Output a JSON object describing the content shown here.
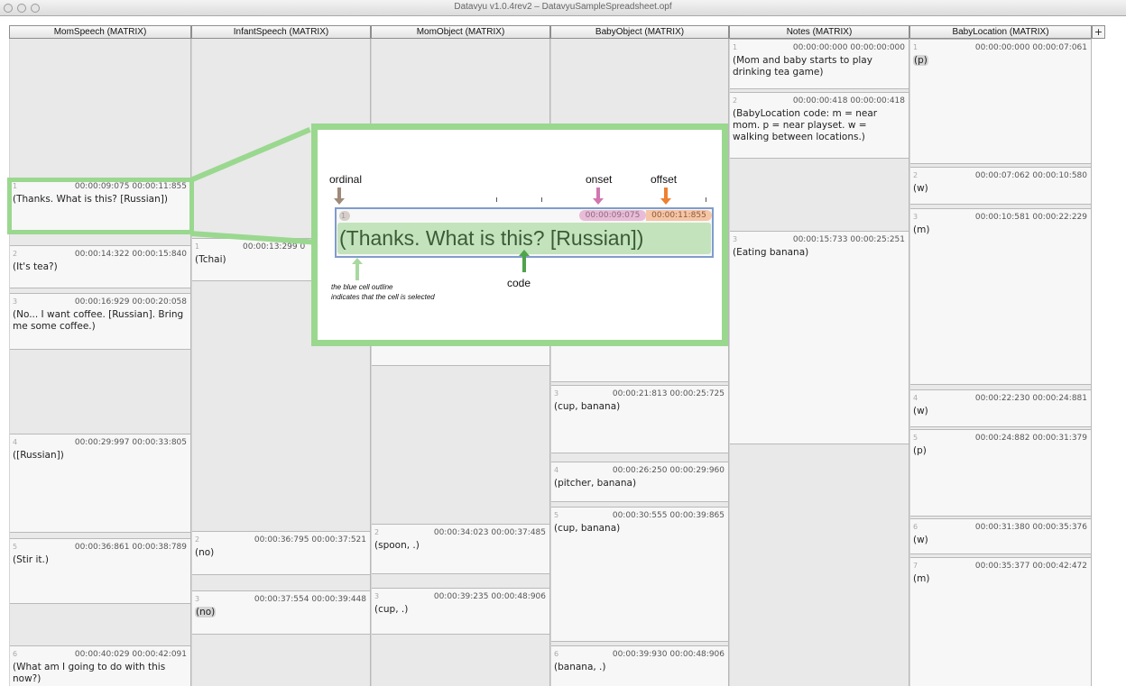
{
  "window": {
    "title": "Datavyu v1.0.4rev2 – DatavyuSampleSpreadsheet.opf"
  },
  "add_column_label": "+",
  "columns": [
    {
      "header": "MomSpeech  (MATRIX)"
    },
    {
      "header": "InfantSpeech  (MATRIX)"
    },
    {
      "header": "MomObject  (MATRIX)"
    },
    {
      "header": "BabyObject  (MATRIX)"
    },
    {
      "header": "Notes  (MATRIX)"
    },
    {
      "header": "BabyLocation  (MATRIX)"
    }
  ],
  "cells": {
    "mom": [
      {
        "ord": "1",
        "onset": "00:00:09:075",
        "offset": "00:00:11:855",
        "value": "(Thanks. What is this? [Russian])"
      },
      {
        "ord": "2",
        "onset": "00:00:14:322",
        "offset": "00:00:15:840",
        "value": "(It's tea?)"
      },
      {
        "ord": "3",
        "onset": "00:00:16:929",
        "offset": "00:00:20:058",
        "value": "(No... I want coffee. [Russian]. Bring me some coffee.)"
      },
      {
        "ord": "4",
        "onset": "00:00:29:997",
        "offset": "00:00:33:805",
        "value": "([Russian])"
      },
      {
        "ord": "5",
        "onset": "00:00:36:861",
        "offset": "00:00:38:789",
        "value": "(Stir it.)"
      },
      {
        "ord": "6",
        "onset": "00:00:40:029",
        "offset": "00:00:42:091",
        "value": "(What am I going to do with this now?)"
      }
    ],
    "infant": [
      {
        "ord": "1",
        "onset": "00:00:13:299",
        "offset": "0",
        "value": "(Tchai)"
      },
      {
        "ord": "2",
        "onset": "00:00:36:795",
        "offset": "00:00:37:521",
        "value": "(no)"
      },
      {
        "ord": "3",
        "onset": "00:00:37:554",
        "offset": "00:00:39:448",
        "value": "(no)"
      }
    ],
    "momobj": [
      {
        "ord": "2",
        "onset": "00:00:34:023",
        "offset": "00:00:37:485",
        "value": "(spoon, .)"
      },
      {
        "ord": "3",
        "onset": "00:00:39:235",
        "offset": "00:00:48:906",
        "value": "(cup, .)"
      }
    ],
    "babyobj": [
      {
        "ord": "3",
        "onset": "00:00:21:813",
        "offset": "00:00:25:725",
        "value": "(cup, banana)"
      },
      {
        "ord": "4",
        "onset": "00:00:26:250",
        "offset": "00:00:29:960",
        "value": "(pitcher, banana)"
      },
      {
        "ord": "5",
        "onset": "00:00:30:555",
        "offset": "00:00:39:865",
        "value": "(cup, banana)"
      },
      {
        "ord": "6",
        "onset": "00:00:39:930",
        "offset": "00:00:48:906",
        "value": "(banana, .)"
      }
    ],
    "notes": [
      {
        "ord": "1",
        "onset": "00:00:00:000",
        "offset": "00:00:00:000",
        "value": "(Mom and baby starts to play drinking tea game)"
      },
      {
        "ord": "2",
        "onset": "00:00:00:418",
        "offset": "00:00:00:418",
        "value": "(BabyLocation code: m = near mom. p = near playset. w = walking between locations.)"
      },
      {
        "ord": "3",
        "onset": "00:00:15:733",
        "offset": "00:00:25:251",
        "value": "(Eating banana)"
      }
    ],
    "babyloc": [
      {
        "ord": "1",
        "onset": "00:00:00:000",
        "offset": "00:00:07:061",
        "value": "(p)"
      },
      {
        "ord": "2",
        "onset": "00:00:07:062",
        "offset": "00:00:10:580",
        "value": "(w)"
      },
      {
        "ord": "3",
        "onset": "00:00:10:581",
        "offset": "00:00:22:229",
        "value": "(m)"
      },
      {
        "ord": "4",
        "onset": "00:00:22:230",
        "offset": "00:00:24:881",
        "value": "(w)"
      },
      {
        "ord": "5",
        "onset": "00:00:24:882",
        "offset": "00:00:31:379",
        "value": "(p)"
      },
      {
        "ord": "6",
        "onset": "00:00:31:380",
        "offset": "00:00:35:376",
        "value": "(w)"
      },
      {
        "ord": "7",
        "onset": "00:00:35:377",
        "offset": "00:00:42:472",
        "value": "(m)"
      }
    ]
  },
  "callout": {
    "ordinal_label": "ordinal",
    "onset_label": "onset",
    "offset_label": "offset",
    "code_label": "code",
    "note_line1": "the blue cell outline",
    "note_line2": "indicates that the cell is selected",
    "cell_ord": "1",
    "cell_onset": "00:00:09:075",
    "cell_offset": "00:00:11:855",
    "cell_value": "(Thanks. What is this? [Russian])",
    "colors": {
      "ordinal": "#9e8a78",
      "onset": "#d176b0",
      "offset": "#ee8030",
      "code": "#4fa34a",
      "note": "#a8d8a0",
      "frame": "#9ad88f",
      "selected_outline": "#7f9ccd"
    }
  }
}
